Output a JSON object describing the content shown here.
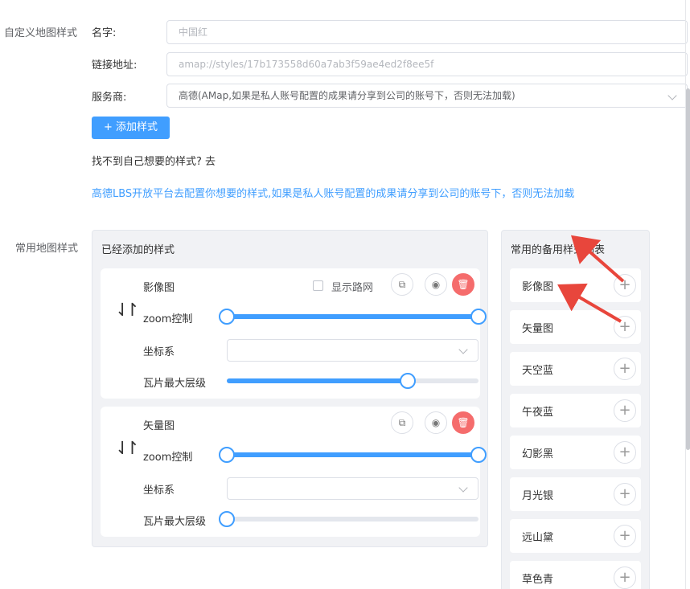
{
  "form": {
    "section_label": "自定义地图样式",
    "name": {
      "label": "名字:",
      "placeholder": "中国红"
    },
    "link": {
      "label": "链接地址:",
      "placeholder": "amap://styles/17b173558d60a7ab3f59ae4ed2f8ee5f"
    },
    "provider": {
      "label": "服务商:",
      "value": "高德(AMap,如果是私人账号配置的成果请分享到公司的账号下，否则无法加载)"
    },
    "add_button": "+ 添加样式",
    "hint": "找不到自己想要的样式?  去",
    "hint_link": "高德LBS开放平台去配置你想要的样式,如果是私人账号配置的成果请分享到公司的账号下，否则无法加载"
  },
  "common": {
    "section_label": "常用地图样式",
    "added_panel": {
      "title": "已经添加的样式",
      "cards": [
        {
          "name": "影像图",
          "show_roads_label": "显示路网",
          "show_roads_checked": false,
          "zoom_label": "zoom控制",
          "zoom_range": [
            0,
            1
          ],
          "coord_label": "坐标系",
          "coord_value": "",
          "max_level_label": "瓦片最大层级",
          "max_level_fraction": 0.72
        },
        {
          "name": "矢量图",
          "zoom_label": "zoom控制",
          "zoom_range": [
            0,
            1
          ],
          "coord_label": "坐标系",
          "coord_value": "",
          "max_level_label": "瓦片最大层级",
          "max_level_fraction": 0.0
        }
      ],
      "icons": {
        "sort": "sort-arrows-icon",
        "copy": "copy-icon",
        "view": "eye-icon",
        "delete": "trash-icon"
      }
    },
    "backup_panel": {
      "title": "常用的备用样式列表",
      "items": [
        "影像图",
        "矢量图",
        "天空蓝",
        "午夜蓝",
        "幻影黑",
        "月光银",
        "远山黛",
        "草色青"
      ]
    }
  },
  "colors": {
    "primary": "#409eff",
    "danger": "#f56c6c",
    "annotation_arrow": "#e8463c"
  }
}
